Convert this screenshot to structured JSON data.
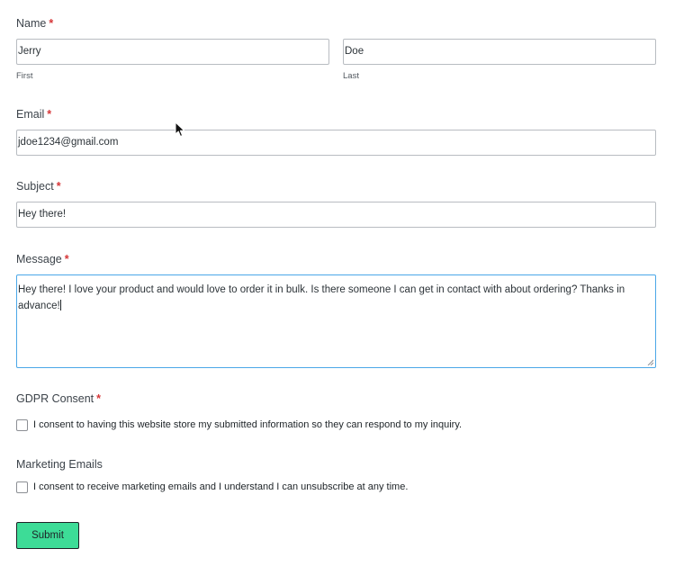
{
  "form": {
    "name": {
      "label": "Name",
      "required_mark": "*",
      "first_value": "Jerry",
      "first_sublabel": "First",
      "last_value": "Doe",
      "last_sublabel": "Last"
    },
    "email": {
      "label": "Email",
      "required_mark": "*",
      "value": "jdoe1234@gmail.com"
    },
    "subject": {
      "label": "Subject",
      "required_mark": "*",
      "value": "Hey there!"
    },
    "message": {
      "label": "Message",
      "required_mark": "*",
      "value": "Hey there! I love your product and would love to order it in bulk. Is there someone I can get in contact with about ordering? Thanks in advance!"
    },
    "gdpr": {
      "label": "GDPR Consent",
      "required_mark": "*",
      "checkbox_label": "I consent to having this website store my submitted information so they can respond to my inquiry.",
      "checked": false
    },
    "marketing": {
      "label": "Marketing Emails",
      "checkbox_label": "I consent to receive marketing emails and I understand I can unsubscribe at any time.",
      "checked": false
    },
    "submit_label": "Submit"
  },
  "colors": {
    "required": "#d63638",
    "submit_bg": "#3ddc97",
    "focus_border": "#4aa7e8"
  },
  "icons": {
    "cursor": "mouse-pointer-icon",
    "resize": "textarea-resize-icon"
  }
}
